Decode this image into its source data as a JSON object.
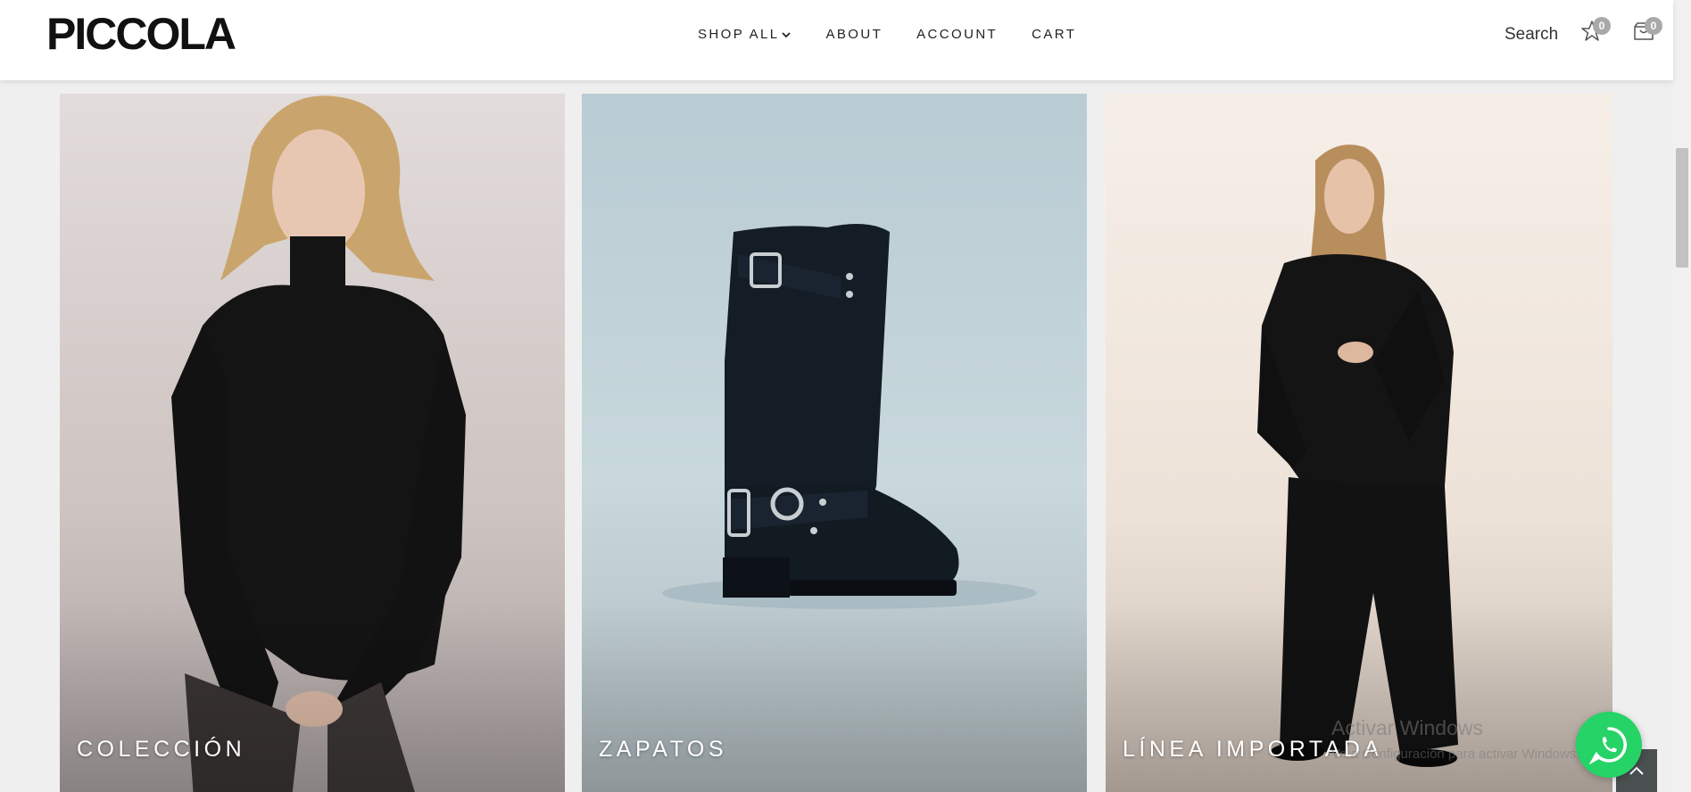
{
  "header": {
    "logo": "PICCOLA",
    "nav": {
      "shop_all": "SHOP ALL",
      "about": "ABOUT",
      "account": "ACCOUNT",
      "cart": "CART"
    },
    "search_label": "Search",
    "wishlist_count": "0",
    "cart_count": "0"
  },
  "categories": [
    {
      "label": "COLECCIÓN"
    },
    {
      "label": "ZAPATOS"
    },
    {
      "label": "LÍNEA IMPORTADA"
    }
  ],
  "watermark": {
    "line1": "Activar Windows",
    "line2": "Ve a Configuración para activar Windows."
  },
  "icons": {
    "wishlist": "star-icon",
    "cart": "cart-icon",
    "whatsapp": "whatsapp-icon",
    "back_to_top": "chevron-up-icon"
  },
  "colors": {
    "whatsapp": "#25d366",
    "badge": "#a9a9a9",
    "header_bg": "#ffffff"
  }
}
